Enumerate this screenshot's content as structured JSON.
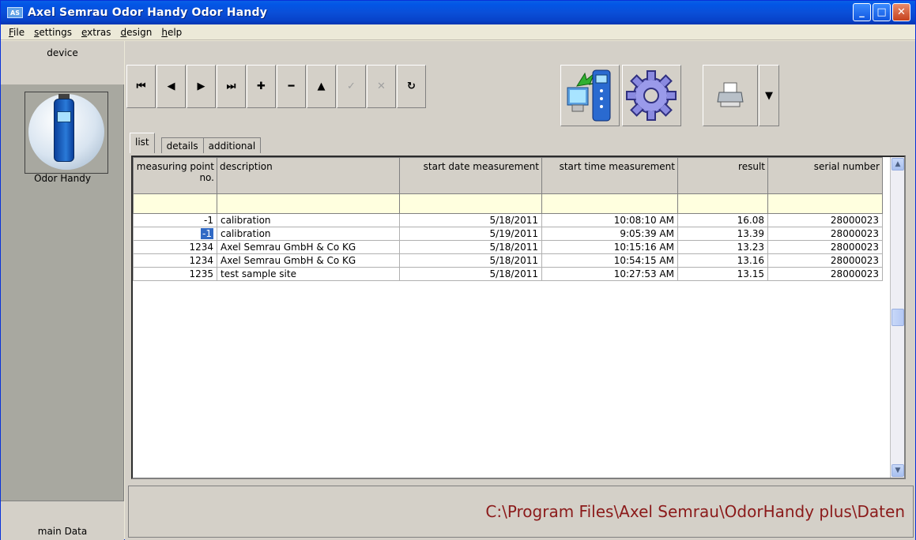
{
  "window": {
    "app_icon_text": "AS",
    "title": "Axel Semrau Odor Handy Odor Handy",
    "minimize_glyph": "_",
    "maximize_glyph": "□",
    "close_glyph": "✕"
  },
  "menu": [
    {
      "first": "F",
      "rest": "ile"
    },
    {
      "first": "s",
      "rest": "ettings"
    },
    {
      "first": "e",
      "rest": "xtras"
    },
    {
      "first": "d",
      "rest": "esign"
    },
    {
      "first": "h",
      "rest": "elp"
    }
  ],
  "sidebar": {
    "header": "device",
    "device_label": "Odor Handy",
    "footer": "main Data"
  },
  "toolbar": {
    "first": "⏮",
    "prior": "◀",
    "next": "▶",
    "last": "⏭",
    "insert": "✚",
    "delete": "━",
    "edit": "▲",
    "post": "✓",
    "cancel": "✕",
    "refresh": "↻",
    "dropdown": "▼"
  },
  "tabs": [
    "list",
    "details",
    "additional"
  ],
  "grid": {
    "headers": [
      "measuring point no.",
      "description",
      "start date measurement",
      "start time measurement",
      "result",
      "serial number"
    ],
    "rows": [
      [
        "-1",
        "calibration",
        "5/18/2011",
        "10:08:10 AM",
        "16.08",
        "28000023"
      ],
      [
        "-1",
        "calibration",
        "5/19/2011",
        "9:05:39 AM",
        "13.39",
        "28000023"
      ],
      [
        "1234",
        "Axel Semrau GmbH & Co KG",
        "5/18/2011",
        "10:15:16 AM",
        "13.23",
        "28000023"
      ],
      [
        "1234",
        "Axel Semrau GmbH & Co KG",
        "5/18/2011",
        "10:54:15 AM",
        "13.16",
        "28000023"
      ],
      [
        "1235",
        "test sample site",
        "5/18/2011",
        "10:27:53 AM",
        "13.15",
        "28000023"
      ]
    ],
    "scroll_up": "▲",
    "scroll_down": "▼"
  },
  "status": {
    "path": "C:\\Program Files\\Axel Semrau\\OdorHandy plus\\Daten"
  }
}
